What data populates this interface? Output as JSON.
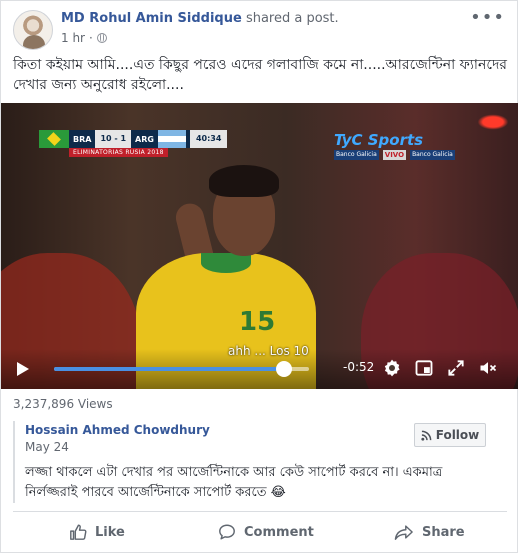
{
  "post": {
    "author": "MD Rohul Amin Siddique",
    "action": "shared a post.",
    "time": "1 hr",
    "privacy_icon": "globe-icon",
    "more_icon": "more-options-icon",
    "text": "কিতা কইয়াম আমি....এত কিছুর পরেও এদের গলাবাজি কমে না.....আরজেন্টিনা ফ্যানদের দেখার জন্য অনুরোধ রইলো...."
  },
  "video": {
    "scorebug": {
      "home": "BRA",
      "score": "10 - 1",
      "away": "ARG",
      "clock": "40:34",
      "sub": "ELIMINATORIAS RUSIA 2018"
    },
    "broadcaster": {
      "name": "TyC Sports",
      "tag_left": "Banco Galicia",
      "tag_live": "VIVO",
      "tag_right": "Banco Galicia"
    },
    "player_number": "15",
    "caption": "ahh ... Los 10",
    "time_remaining": "-0:52",
    "progress_percent": 90,
    "controls": {
      "play_icon": "play-icon",
      "settings_icon": "gear-icon",
      "pip_icon": "picture-in-picture-icon",
      "fullscreen_icon": "expand-icon",
      "volume_icon": "mute-icon"
    }
  },
  "stats": {
    "views": "3,237,896 Views"
  },
  "original": {
    "author": "Hossain Ahmed Chowdhury",
    "date": "May 24",
    "follow_label": "Follow",
    "text": "লজ্জা থাকলে এটা দেখার পর আর্জেন্টিনাকে আর কেউ সাপোর্ট করবে না। একমাত্র নির্লজ্জরাই পারবে আর্জেন্টিনাকে সাপোর্ট করতে 😂"
  },
  "actions": {
    "like": "Like",
    "comment": "Comment",
    "share": "Share"
  },
  "colors": {
    "link": "#365899",
    "muted": "#616770",
    "progress": "#4a90e2",
    "border": "#dddfe2"
  }
}
